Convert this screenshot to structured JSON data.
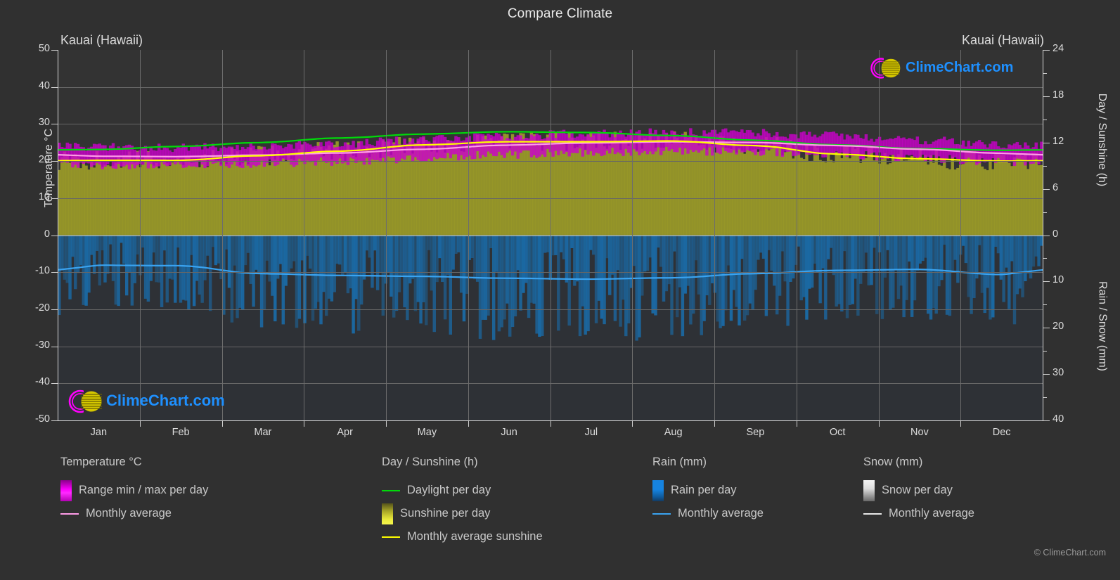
{
  "header": {
    "title": "Compare Climate"
  },
  "locations": {
    "left": "Kauai (Hawaii)",
    "right": "Kauai (Hawaii)"
  },
  "axes": {
    "left_title": "Temperature °C",
    "right_title_top": "Day / Sunshine (h)",
    "right_title_bottom": "Rain / Snow (mm)",
    "left_ticks": [
      "50",
      "40",
      "30",
      "20",
      "10",
      "0",
      "-10",
      "-20",
      "-30",
      "-40",
      "-50"
    ],
    "right_ticks_top": [
      "24",
      "18",
      "12",
      "6",
      "0"
    ],
    "right_ticks_bottom": [
      "10",
      "20",
      "30",
      "40"
    ],
    "x_ticks": [
      "Jan",
      "Feb",
      "Mar",
      "Apr",
      "May",
      "Jun",
      "Jul",
      "Aug",
      "Sep",
      "Oct",
      "Nov",
      "Dec"
    ]
  },
  "legend": {
    "temperature": {
      "head": "Temperature °C",
      "items": [
        {
          "label": "Range min / max per day",
          "kind": "box",
          "color": "#ff00ff"
        },
        {
          "label": "Monthly average",
          "kind": "line",
          "color": "#ff9ce8"
        }
      ]
    },
    "day": {
      "head": "Day / Sunshine (h)",
      "items": [
        {
          "label": "Daylight per day",
          "kind": "line",
          "color": "#00d90a"
        },
        {
          "label": "Sunshine per day",
          "kind": "box",
          "color": "#f2f22a"
        },
        {
          "label": "Monthly average sunshine",
          "kind": "line",
          "color": "#ffff00"
        }
      ]
    },
    "rain": {
      "head": "Rain (mm)",
      "items": [
        {
          "label": "Rain per day",
          "kind": "box",
          "color": "#1683e0"
        },
        {
          "label": "Monthly average",
          "kind": "line",
          "color": "#3aa3f0"
        }
      ]
    },
    "snow": {
      "head": "Snow (mm)",
      "items": [
        {
          "label": "Snow per day",
          "kind": "box",
          "color": "#f0f0f0"
        },
        {
          "label": "Monthly average",
          "kind": "line",
          "color": "#e8e8e8"
        }
      ]
    }
  },
  "branding": {
    "logo_text": "ClimeChart.com",
    "copyright": "© ClimeChart.com"
  },
  "colors": {
    "background": "#303030",
    "plot_bg_top": "#333333",
    "plot_bg_bottom": "#2e3136",
    "grid": "#666666",
    "axis": "#d8d8d8",
    "text": "#dddddd",
    "temp_range": "#cc00cc",
    "temp_avg": "#ff9ce8",
    "daylight": "#00d90a",
    "sunshine_fill": "#9a9a28",
    "sunshine_avg": "#ffff00",
    "rain_fill": "#1a6ba8",
    "rain_avg": "#3aa3f0"
  },
  "chart_data": {
    "type": "area",
    "title": "Compare Climate",
    "subtitle": "Kauai (Hawaii)",
    "xlabel": "",
    "ylabel": "Temperature °C",
    "ylim": [
      -50,
      50
    ],
    "y2lim_top": [
      0,
      24
    ],
    "y2lim_bottom": [
      0,
      40
    ],
    "grid": true,
    "legend_position": "below",
    "categories": [
      "Jan",
      "Feb",
      "Mar",
      "Apr",
      "May",
      "Jun",
      "Jul",
      "Aug",
      "Sep",
      "Oct",
      "Nov",
      "Dec"
    ],
    "series": [
      {
        "name": "Monthly average temperature (°C)",
        "unit": "°C",
        "axis": "left",
        "values": [
          21.3,
          21.2,
          21.6,
          22.2,
          23.2,
          24.3,
          24.9,
          25.2,
          25.0,
          24.2,
          23.2,
          22.1
        ]
      },
      {
        "name": "Daily max temperature (°C)",
        "unit": "°C",
        "axis": "left",
        "values": [
          23.5,
          23.4,
          23.8,
          24.5,
          25.6,
          26.6,
          27.2,
          27.5,
          27.4,
          26.6,
          25.5,
          24.3
        ]
      },
      {
        "name": "Daily min temperature (°C)",
        "unit": "°C",
        "axis": "left",
        "values": [
          19.2,
          19.0,
          19.5,
          20.1,
          21.0,
          22.0,
          22.6,
          22.9,
          22.7,
          22.0,
          21.0,
          19.9
        ]
      },
      {
        "name": "Daylight per day (h)",
        "unit": "h",
        "axis": "right_top",
        "values": [
          11.1,
          11.5,
          12.0,
          12.6,
          13.1,
          13.4,
          13.3,
          12.9,
          12.3,
          11.7,
          11.2,
          11.0
        ]
      },
      {
        "name": "Monthly average sunshine (h)",
        "unit": "h",
        "axis": "right_top",
        "values": [
          9.7,
          9.7,
          10.3,
          10.9,
          11.7,
          12.1,
          12.1,
          12.2,
          11.6,
          10.5,
          9.9,
          9.6
        ]
      },
      {
        "name": "Monthly average rain (mm/day)",
        "unit": "mm",
        "axis": "right_bottom",
        "values": [
          6.5,
          6.6,
          8.3,
          8.7,
          8.9,
          9.3,
          9.5,
          9.2,
          8.3,
          7.6,
          7.4,
          8.5
        ]
      },
      {
        "name": "Monthly average snow (mm/day)",
        "unit": "mm",
        "axis": "right_bottom",
        "values": [
          0,
          0,
          0,
          0,
          0,
          0,
          0,
          0,
          0,
          0,
          0,
          0
        ]
      }
    ]
  }
}
